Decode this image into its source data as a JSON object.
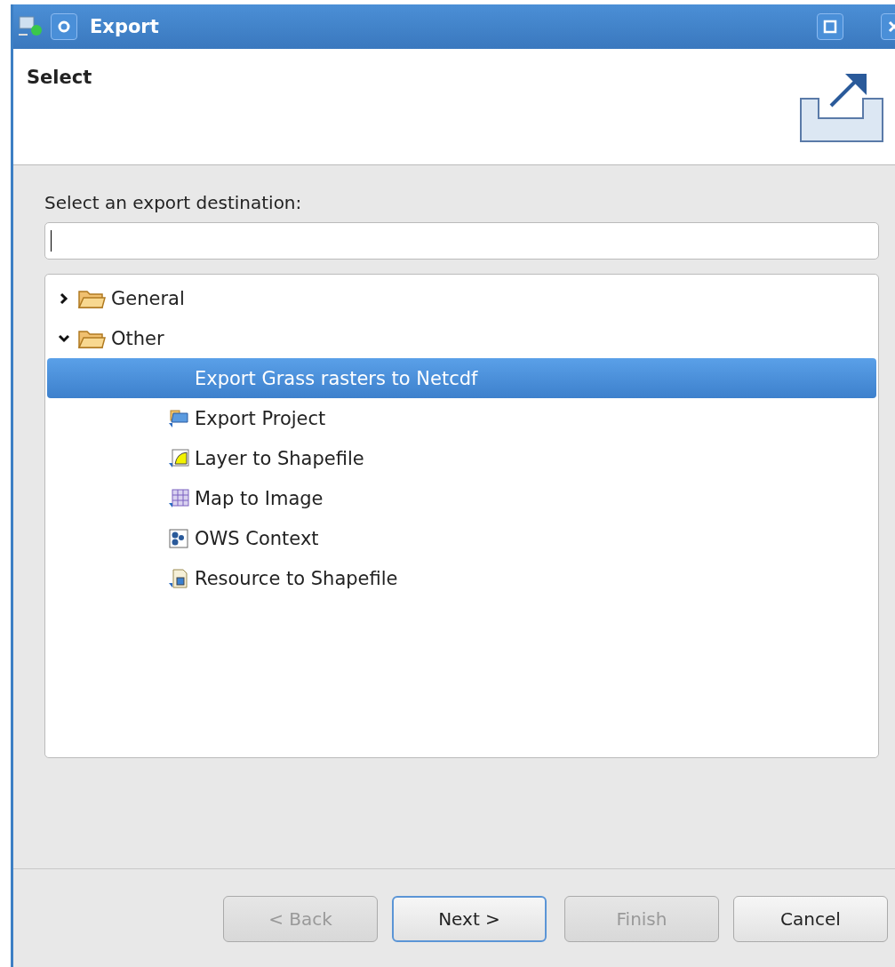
{
  "window": {
    "title": "Export"
  },
  "header": {
    "title": "Select"
  },
  "prompt": "Select an export destination:",
  "filter": {
    "focused": true
  },
  "tree": [
    {
      "label": "General",
      "expanded": false,
      "selected": false
    },
    {
      "label": "Other",
      "expanded": true,
      "selected": false,
      "children": [
        {
          "label": "Export Grass rasters to Netcdf",
          "selected": true
        },
        {
          "label": "Export Project",
          "selected": false
        },
        {
          "label": "Layer to Shapefile",
          "selected": false
        },
        {
          "label": "Map to Image",
          "selected": false
        },
        {
          "label": "OWS Context",
          "selected": false
        },
        {
          "label": "Resource to Shapefile",
          "selected": false
        }
      ]
    }
  ],
  "buttons": [
    {
      "label": "< Back",
      "disabled": true,
      "default": false
    },
    {
      "label": "Next >",
      "disabled": false,
      "default": true
    },
    {
      "label": "Finish",
      "disabled": true,
      "default": false
    },
    {
      "label": "Cancel",
      "disabled": false,
      "default": false
    }
  ]
}
